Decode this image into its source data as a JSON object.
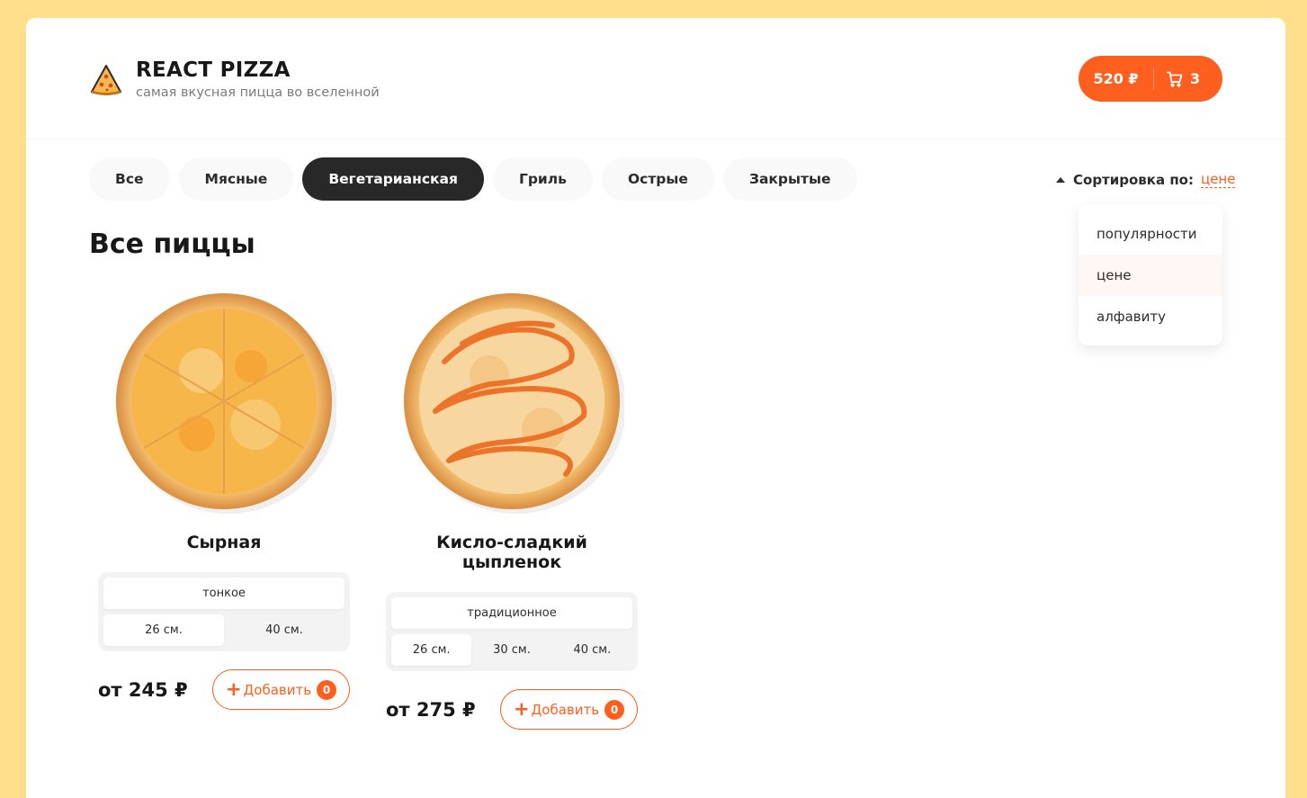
{
  "header": {
    "title": "REACT PIZZA",
    "subtitle": "самая вкусная пицца во вселенной",
    "cart": {
      "price": "520 ₽",
      "count": "3"
    }
  },
  "categories": [
    {
      "label": "Все",
      "active": false
    },
    {
      "label": "Мясные",
      "active": false
    },
    {
      "label": "Вегетарианская",
      "active": true
    },
    {
      "label": "Гриль",
      "active": false
    },
    {
      "label": "Острые",
      "active": false
    },
    {
      "label": "Закрытые",
      "active": false
    }
  ],
  "sort": {
    "label": "Сортировка по:",
    "value": "цене",
    "options": [
      "популярности",
      "цене",
      "алфавиту"
    ],
    "selected_index": 1
  },
  "content_title": "Все пиццы",
  "pizzas": [
    {
      "name": "Сырная",
      "types": [
        "тонкое"
      ],
      "sizes": [
        "26 см.",
        "40 см."
      ],
      "price": "от 245 ₽",
      "add_label": "Добавить",
      "add_count": "0"
    },
    {
      "name": "Кисло-сладкий цыпленок",
      "types": [
        "традиционное"
      ],
      "sizes": [
        "26 см.",
        "30 см.",
        "40 см."
      ],
      "price": "от 275 ₽",
      "add_label": "Добавить",
      "add_count": "0"
    }
  ],
  "colors": {
    "accent": "#fe5f1e",
    "background": "#ffdf8c",
    "dark": "#282828"
  }
}
